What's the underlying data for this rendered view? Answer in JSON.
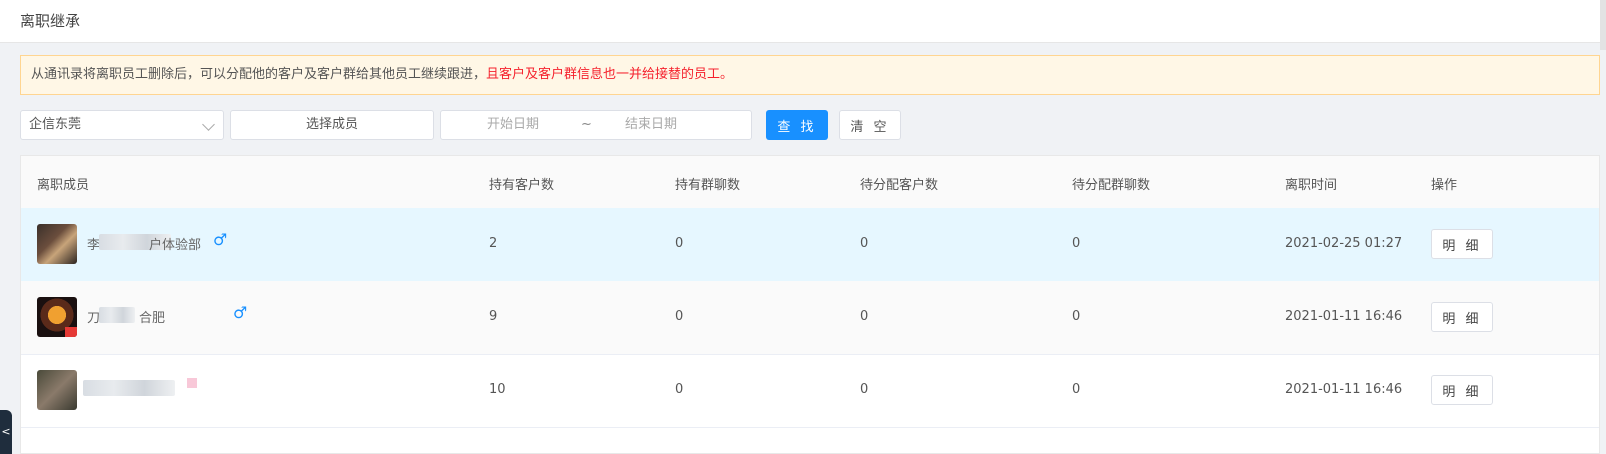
{
  "page": {
    "title": "离职继承"
  },
  "notice": {
    "text": "从通讯录将离职员工删除后，可以分配他的客户及客户群给其他员工继续跟进，",
    "warning": "且客户及客户群信息也一并给接替的员工。"
  },
  "filters": {
    "corp_select": "企信东莞",
    "member_select": "选择成员",
    "start_date_placeholder": "开始日期",
    "date_separator": "~",
    "end_date_placeholder": "结束日期",
    "search_label": "查 找",
    "clear_label": "清 空"
  },
  "table": {
    "headers": [
      "离职成员",
      "持有客户数",
      "持有群聊数",
      "待分配客户数",
      "待分配群聊数",
      "离职时间",
      "操作"
    ],
    "rows": [
      {
        "name_visible_start": "李",
        "name_visible_end": "户体验部",
        "customers": "2",
        "groups": "0",
        "pending_customers": "0",
        "pending_groups": "0",
        "time": "2021-02-25 01:27",
        "action": "明 细",
        "gender_icon": "♂"
      },
      {
        "name_visible_start": "刀",
        "name_visible_end": "合肥",
        "customers": "9",
        "groups": "0",
        "pending_customers": "0",
        "pending_groups": "0",
        "time": "2021-01-11 16:46",
        "action": "明 细",
        "gender_icon": "♂"
      },
      {
        "name_visible_start": "",
        "name_visible_end": "",
        "customers": "10",
        "groups": "0",
        "pending_customers": "0",
        "pending_groups": "0",
        "time": "2021-01-11 16:46",
        "action": "明 细",
        "gender_icon": ""
      }
    ]
  },
  "side_tab": {
    "glyph": "<"
  },
  "colors": {
    "primary": "#1890ff",
    "warning_text": "#f5222d",
    "notice_bg": "#fff7e6",
    "highlight_row": "#e6f7ff"
  }
}
